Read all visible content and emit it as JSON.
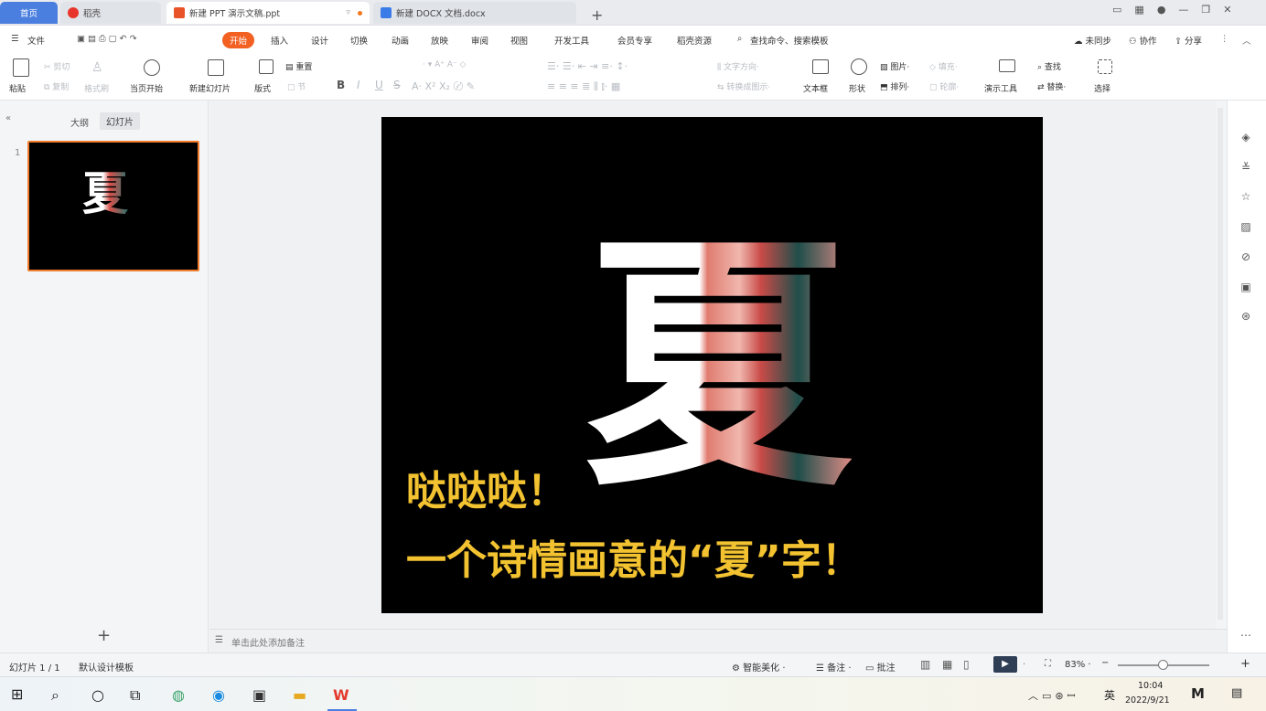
{
  "titlebar": {
    "tabs": [
      {
        "label": "首页"
      },
      {
        "label": "稻壳"
      },
      {
        "label": "新建 PPT 演示文稿.ppt"
      },
      {
        "label": "新建 DOCX 文档.docx"
      }
    ]
  },
  "menu": {
    "file": "文件",
    "items": [
      "开始",
      "插入",
      "设计",
      "切换",
      "动画",
      "放映",
      "审阅",
      "视图",
      "开发工具",
      "会员专享",
      "稻壳资源"
    ],
    "search": "查找命令、搜索模板",
    "sync": "未同步",
    "collab": "协作",
    "share": "分享"
  },
  "ribbon": {
    "paste": "粘贴",
    "cut": "剪切",
    "copy": "复制",
    "format_painter": "格式刷",
    "play_from_current": "当页开始",
    "new_slide": "新建幻灯片",
    "layout": "版式",
    "section": "节",
    "reset": "重置",
    "bold": "B",
    "italic": "I",
    "underline": "U",
    "strike": "S",
    "textbox": "文本框",
    "shape": "形状",
    "picture": "图片",
    "arrange": "排列",
    "fill": "填充",
    "outline": "轮廓",
    "present_tools": "演示工具",
    "find": "查找",
    "replace": "替换",
    "select": "选择"
  },
  "panel": {
    "outline_tab": "大纲",
    "slides_tab": "幻灯片",
    "slide_number": "1",
    "add": "+"
  },
  "slide": {
    "big_char": "夏",
    "line1": "哒哒哒！",
    "line2": "一个诗情画意的“夏”字！",
    "accent": "#f2c230"
  },
  "notes": {
    "placeholder": "单击此处添加备注"
  },
  "status": {
    "slide_count": "幻灯片 1 / 1",
    "theme": "默认设计模板",
    "smart_beautify": "智能美化",
    "notes": "备注",
    "comments": "批注",
    "zoom": "83%"
  },
  "taskbar": {
    "time": "10:04",
    "date": "2022/9/21",
    "lang": "英"
  }
}
